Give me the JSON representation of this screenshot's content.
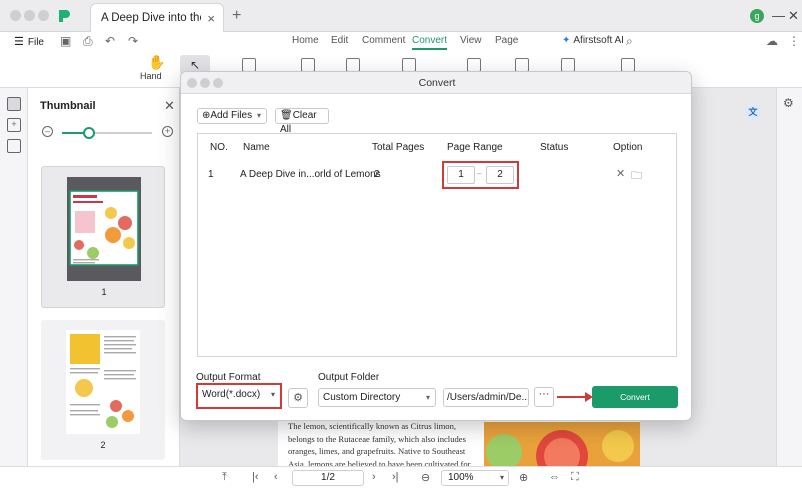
{
  "tab": {
    "title": "A Deep Dive into the Wor...",
    "close": "×",
    "add": "+"
  },
  "user": {
    "avatar_initial": "g"
  },
  "menu": {
    "file": "File",
    "tabs": [
      "Home",
      "Edit",
      "Comment",
      "Convert",
      "View",
      "Page"
    ],
    "active_tab": "Convert",
    "ai": "Afirstsoft AI"
  },
  "toolbar": {
    "hand_label": "Hand"
  },
  "thumbnail_panel": {
    "title": "Thumbnail",
    "zoom_level": 0.3,
    "pages": [
      {
        "number": "1"
      },
      {
        "number": "2"
      }
    ]
  },
  "document": {
    "paragraph": "The lemon, scientifically known as Citrus limon, belongs to the Rutaceae family, which also includes oranges, limes, and grapefruits. Native to Southeast Asia, lemons are believed to have been cultivated for"
  },
  "status_bar": {
    "page_input": "1/2",
    "zoom": "100%"
  },
  "dialog": {
    "title": "Convert",
    "add_files": "Add Files",
    "clear_all": "Clear All",
    "columns": {
      "no": "NO.",
      "name": "Name",
      "total_pages": "Total Pages",
      "page_range": "Page Range",
      "status": "Status",
      "option": "Option"
    },
    "rows": [
      {
        "no": "1",
        "name": "A Deep Dive in...orld of Lemons",
        "total_pages": "2",
        "range_from": "1",
        "range_to": "2",
        "status": ""
      }
    ],
    "output_format_label": "Output Format",
    "output_format_value": "Word(*.docx)",
    "output_folder_label": "Output Folder",
    "output_folder_value": "Custom Directory",
    "folder_path": "/Users/admin/De...",
    "browse": "···",
    "convert_button": "Convert"
  },
  "colors": {
    "accent": "#1b9a6a",
    "highlight": "#d13a3a"
  }
}
